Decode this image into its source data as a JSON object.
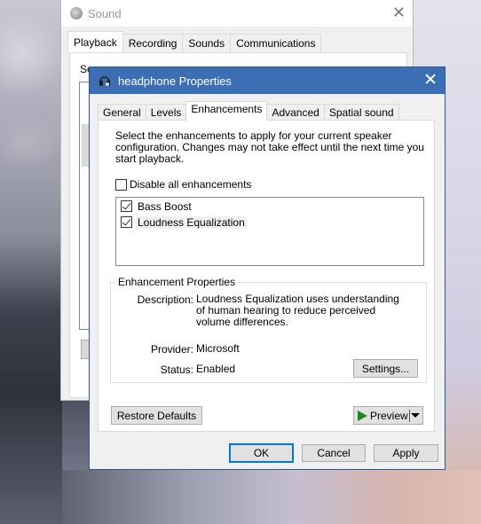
{
  "background_window": {
    "title": "Sound",
    "tabs": [
      {
        "label": "Playback",
        "active": true
      },
      {
        "label": "Recording",
        "active": false
      },
      {
        "label": "Sounds",
        "active": false
      },
      {
        "label": "Communications",
        "active": false
      }
    ],
    "partial_text": "Se",
    "close_glyph": "✕"
  },
  "dialog": {
    "title": "headphone Properties",
    "close_glyph": "✕",
    "tabs": [
      {
        "label": "General",
        "active": false
      },
      {
        "label": "Levels",
        "active": false
      },
      {
        "label": "Enhancements",
        "active": true
      },
      {
        "label": "Advanced",
        "active": false
      },
      {
        "label": "Spatial sound",
        "active": false
      }
    ],
    "intro_text": "Select the enhancements to apply for your current speaker configuration. Changes may not take effect until the next time you start playback.",
    "disable_all": {
      "label": "Disable all enhancements",
      "checked": false
    },
    "enhancements": [
      {
        "label": "Bass Boost",
        "checked": true,
        "selected": false
      },
      {
        "label": "Loudness Equalization",
        "checked": true,
        "selected": true
      }
    ],
    "properties": {
      "legend": "Enhancement Properties",
      "description_label": "Description:",
      "description": "Loudness Equalization uses understanding of human hearing to reduce perceived volume differences.",
      "provider_label": "Provider:",
      "provider": "Microsoft",
      "status_label": "Status:",
      "status": "Enabled",
      "settings_button": "Settings..."
    },
    "restore_defaults_button": "Restore Defaults",
    "preview_button": "Preview",
    "ok_button": "OK",
    "cancel_button": "Cancel",
    "apply_button": "Apply"
  },
  "colors": {
    "title_bar": "#3c6eb4",
    "default_button_border": "#0078d7",
    "play_icon": "#1b8a1b"
  }
}
